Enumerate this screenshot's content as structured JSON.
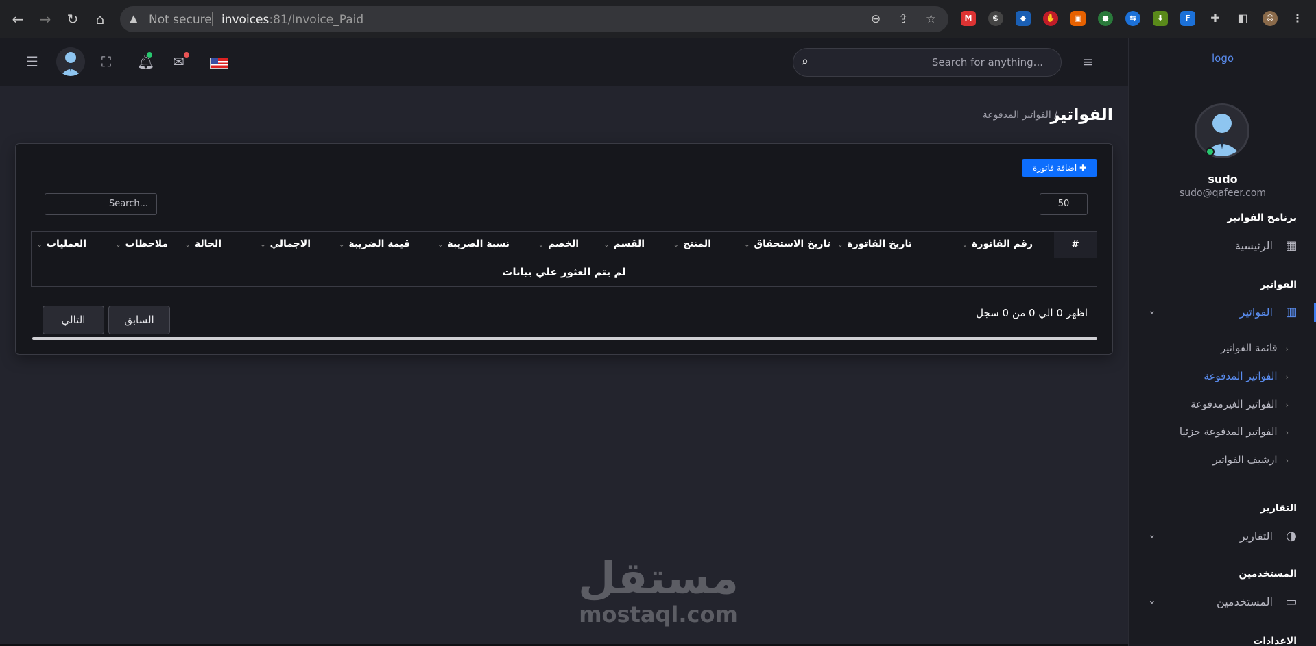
{
  "browser": {
    "security": "Not secure",
    "url_host": "invoices",
    "url_port": ":81",
    "url_path": "/Invoice_Paid"
  },
  "sidebar": {
    "logo": "logo",
    "user_name": "sudo",
    "user_email": "sudo@qafeer.com",
    "section_program": "برنامج الفواتير",
    "home": "الرئيسية",
    "section_invoices": "الفواتير",
    "invoices": "الفواتير",
    "sub_items": [
      "قائمة الفواتير",
      "الفواتير المدفوعة",
      "الفواتير الغيرمدفوعة",
      "الفواتير المدفوعة جزئيا",
      "ارشيف الفواتير"
    ],
    "section_reports": "التقارير",
    "reports": "التقارير",
    "section_users": "المستخدمين",
    "users": "المستخدمين",
    "section_settings": "الاعدادات"
  },
  "topbar": {
    "search_placeholder": "Search for anything..."
  },
  "page": {
    "title": "الفواتير",
    "breadcrumb": "/  الفواتير المدفوعة"
  },
  "table": {
    "add_button": "اضافة فاتورة",
    "page_length": "50",
    "search_placeholder": "Search...",
    "hash": "#",
    "columns": [
      "رقم الفاتورة",
      "تاريخ الفاتورة",
      "تاريخ الاستحقاق",
      "المنتج",
      "القسم",
      "الخصم",
      "نسبة الضريبة",
      "قيمة الضريبة",
      "الاجمالي",
      "الحالة",
      "ملاحظات",
      "العمليات"
    ],
    "empty_message": "لم يتم العثور علي بيانات",
    "info": "اظهر 0 الي 0 من 0 سجل",
    "prev": "السابق",
    "next": "التالي"
  },
  "watermark": {
    "arabic": "مستقل",
    "latin": "mostaql.com"
  }
}
